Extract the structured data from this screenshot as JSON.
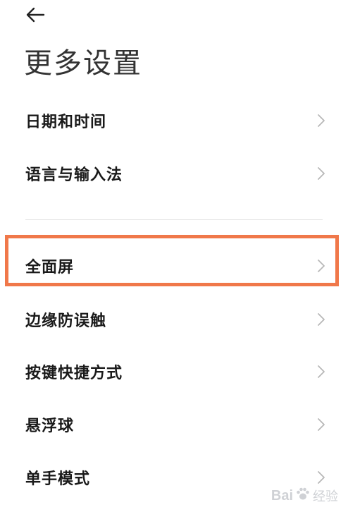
{
  "header": {
    "back_icon": "arrow-left-icon",
    "title": "更多设置"
  },
  "settings": {
    "group1": [
      {
        "label": "日期和时间",
        "icon": "chevron-right-icon"
      },
      {
        "label": "语言与输入法",
        "icon": "chevron-right-icon"
      }
    ],
    "group2": [
      {
        "label": "全面屏",
        "icon": "chevron-right-icon",
        "highlighted": true
      },
      {
        "label": "边缘防误触",
        "icon": "chevron-right-icon"
      },
      {
        "label": "按键快捷方式",
        "icon": "chevron-right-icon"
      },
      {
        "label": "悬浮球",
        "icon": "chevron-right-icon"
      },
      {
        "label": "单手模式",
        "icon": "chevron-right-icon"
      }
    ]
  },
  "watermark": {
    "brand": "Bai",
    "paw_icon": "paw-icon",
    "suffix": "经验"
  },
  "colors": {
    "highlight": "#f0784a",
    "chevron": "#b8b8b8",
    "divider": "#e6e6e6",
    "text": "#1a1a1a",
    "background": "#ffffff"
  }
}
